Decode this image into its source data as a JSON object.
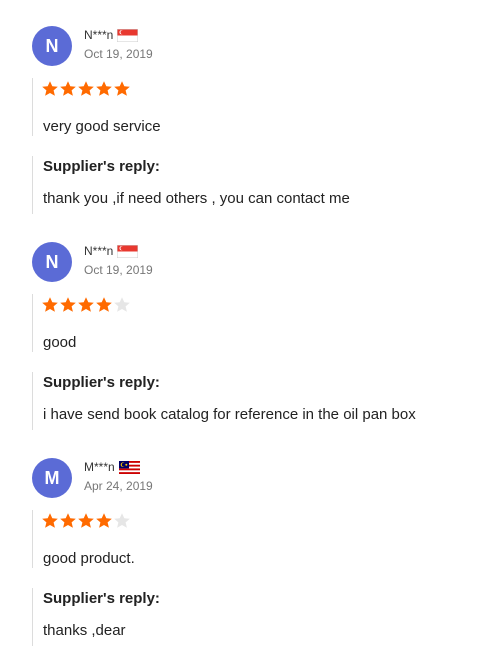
{
  "reviews": [
    {
      "initial": "N",
      "username": "N***n",
      "country_flag": "singapore-flag",
      "date": "Oct 19, 2019",
      "rating": 5,
      "comment": "very good service",
      "reply_title": "Supplier's reply:",
      "reply_text": "thank you ,if need others , you can contact me"
    },
    {
      "initial": "N",
      "username": "N***n",
      "country_flag": "singapore-flag",
      "date": "Oct 19, 2019",
      "rating": 4,
      "comment": "good",
      "reply_title": "Supplier's reply:",
      "reply_text": "i have send book catalog for reference in the oil pan box"
    },
    {
      "initial": "M",
      "username": "M***n",
      "country_flag": "malaysia-flag",
      "date": "Apr 24, 2019",
      "rating": 4,
      "comment": "good product.",
      "reply_title": "Supplier's reply:",
      "reply_text": "thanks ,dear"
    }
  ],
  "colors": {
    "avatar": "#5b6bd6",
    "star_filled": "#ff6a00",
    "star_empty": "#e6e6e6"
  }
}
